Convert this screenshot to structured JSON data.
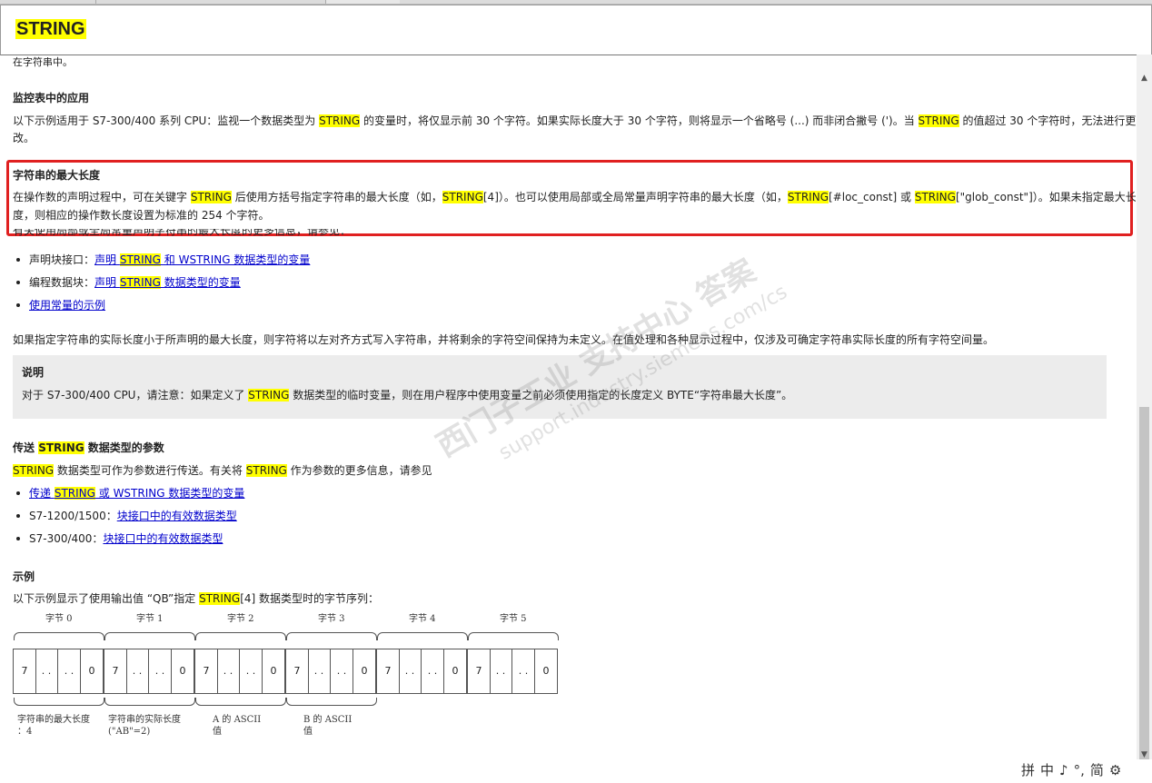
{
  "page": {
    "title": "STRING"
  },
  "top_fragment": "在字符串中。",
  "monitor": {
    "heading": "监控表中的应用",
    "l1_a": "以下示例适用于 S7-300/400 系列 CPU：监视一个数据类型为 ",
    "l1_hl": "STRING",
    "l1_b": " 的变量时，将仅显示前 30 个字符。如果实际长度大于 30 个字符，则将显示一个省略号 (...) 而非闭合撇号 (')。当 ",
    "l1_hl2": "STRING",
    "l1_c": " 的值超过 30 个字符时，无法进行更",
    "l2": "改。"
  },
  "maxlen": {
    "heading": "字符串的最大长度",
    "l1_a": "在操作数的声明过程中，可在关键字 ",
    "hl1": "STRING",
    "l1_b": " 后使用方括号指定字符串的最大长度（如，",
    "hl2": "STRING",
    "l1_c": "[4]）。也可以使用局部或全局常量声明字符串的最大长度（如，",
    "hl3": "STRING",
    "l1_d": "[#loc_const] 或 ",
    "hl4": "STRING",
    "l1_e": "[\"glob_const\"]）。如果未指定最大长",
    "l2": "度，则相应的操作数长度设置为标准的 254 个字符。",
    "more": "有关使用局部或全局常量声明字符串的最大长度的更多信息，请参见：",
    "b1_label": "声明块接口：",
    "b1_a": "声明 ",
    "b1_hl": "STRING",
    "b1_b": " 和 WSTRING 数据类型的变量",
    "b2_label": "编程数据块：",
    "b2_a": "声明 ",
    "b2_hl": "STRING",
    "b2_b": " 数据类型的变量",
    "b3": "使用常量的示例"
  },
  "fill_text": "如果指定字符串的实际长度小于所声明的最大长度，则字符将以左对齐方式写入字符串，并将剩余的字符空间保持为未定义。在值处理和各种显示过程中，仅涉及可确定字符串实际长度的所有字符空间量。",
  "note": {
    "title": "说明",
    "a": "对于 S7-300/400 CPU，请注意：如果定义了 ",
    "hl": "STRING",
    "b": " 数据类型的临时变量，则在用户程序中使用变量之前必须使用指定的长度定义 BYTE“字符串最大长度”。"
  },
  "transfer": {
    "h_a": "传送 ",
    "h_hl": "STRING",
    "h_b": " 数据类型的参数",
    "l_hl": "STRING",
    "l_a": " 数据类型可作为参数进行传送。有关将 ",
    "l_hl2": "STRING",
    "l_b": " 作为参数的更多信息，请参见",
    "b1_a": "传递 ",
    "b1_hl": "STRING",
    "b1_b": " 或 WSTRING 数据类型的变量",
    "b2_label": "S7-1200/1500：",
    "b2_link": "块接口中的有效数据类型",
    "b3_label": "S7-300/400：",
    "b3_link": "块接口中的有效数据类型"
  },
  "example": {
    "heading": "示例",
    "l_a": "以下示例显示了使用输出值 “QB”指定 ",
    "l_hl": "STRING",
    "l_b": "[4] 数据类型时的字节序列：",
    "bytes": [
      "字节 0",
      "字节 1",
      "字节 2",
      "字节 3",
      "字节 4",
      "字节 5"
    ],
    "cells": [
      "7",
      ". .",
      ". .",
      "0"
    ],
    "desc": [
      [
        "字符串的最大长度",
        "：4"
      ],
      [
        "字符串的实际长度",
        "(\"AB\"=2)"
      ],
      [
        "A 的 ASCII",
        "值"
      ],
      [
        "B 的 ASCII",
        "值"
      ]
    ]
  },
  "watermark": {
    "line1": "西门子工业 支持中心 答案",
    "line2": "support.industry.siemens.com/cs"
  },
  "ime": {
    "items": [
      "拼",
      "中",
      "♪",
      "°,",
      "简",
      "⚙"
    ]
  }
}
